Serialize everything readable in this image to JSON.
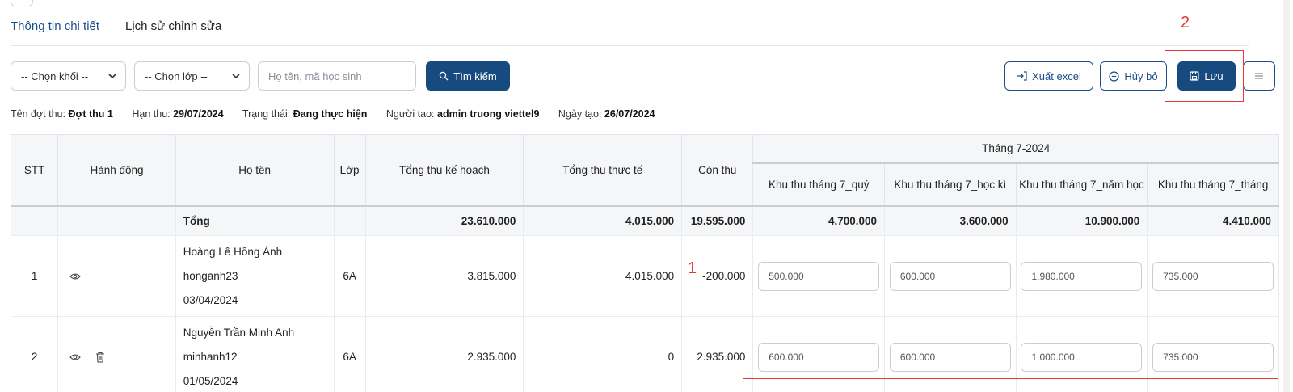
{
  "tabs": [
    {
      "label": "Thông tin chi tiết",
      "active": true
    },
    {
      "label": "Lịch sử chỉnh sửa",
      "active": false
    }
  ],
  "filters": {
    "grade_select": "-- Chọn khối --",
    "class_select": "-- Chọn lớp --",
    "search_placeholder": "Họ tên, mã học sinh",
    "search_button": "Tìm kiếm"
  },
  "actions": {
    "export_label": "Xuất excel",
    "cancel_label": "Hủy bỏ",
    "save_label": "Lưu"
  },
  "annotations": {
    "one": "1",
    "two": "2"
  },
  "info": {
    "period_label": "Tên đợt thu:",
    "period_value": "Đợt thu 1",
    "deadline_label": "Hạn thu:",
    "deadline_value": "29/07/2024",
    "status_label": "Trạng thái:",
    "status_value": "Đang thực hiện",
    "creator_label": "Người tạo:",
    "creator_value": "admin truong viettel9",
    "created_label": "Ngày tạo:",
    "created_value": "26/07/2024"
  },
  "table": {
    "headers": {
      "stt": "STT",
      "action": "Hành động",
      "name": "Họ tên",
      "class": "Lớp",
      "planned": "Tổng thu kế hoạch",
      "actual": "Tổng thu thực tế",
      "remaining": "Còn thu",
      "month_group": "Tháng 7-2024",
      "fee1": "Khu thu tháng 7_quý",
      "fee2": "Khu thu tháng 7_học kì",
      "fee3": "Khu thu tháng 7_năm học",
      "fee4": "Khu thu tháng 7_tháng"
    },
    "total": {
      "label": "Tổng",
      "planned": "23.610.000",
      "actual": "4.015.000",
      "remaining": "19.595.000",
      "fee1": "4.700.000",
      "fee2": "3.600.000",
      "fee3": "10.900.000",
      "fee4": "4.410.000"
    },
    "rows": [
      {
        "stt": "1",
        "name": "Hoàng Lê Hồng Ánh",
        "code": "honganh23",
        "dob": "03/04/2024",
        "class": "6A",
        "planned": "3.815.000",
        "actual": "4.015.000",
        "remaining": "-200.000",
        "fee1": "500.000",
        "fee2": "600.000",
        "fee3": "1.980.000",
        "fee4": "735.000",
        "has_delete": false
      },
      {
        "stt": "2",
        "name": "Nguyễn Trần Minh Anh",
        "code": "minhanh12",
        "dob": "01/05/2024",
        "class": "6A",
        "planned": "2.935.000",
        "actual": "0",
        "remaining": "2.935.000",
        "fee1": "600.000",
        "fee2": "600.000",
        "fee3": "1.000.000",
        "fee4": "735.000",
        "has_delete": true
      }
    ]
  },
  "colors": {
    "primary": "#174a7f",
    "annotation": "#e53935"
  }
}
